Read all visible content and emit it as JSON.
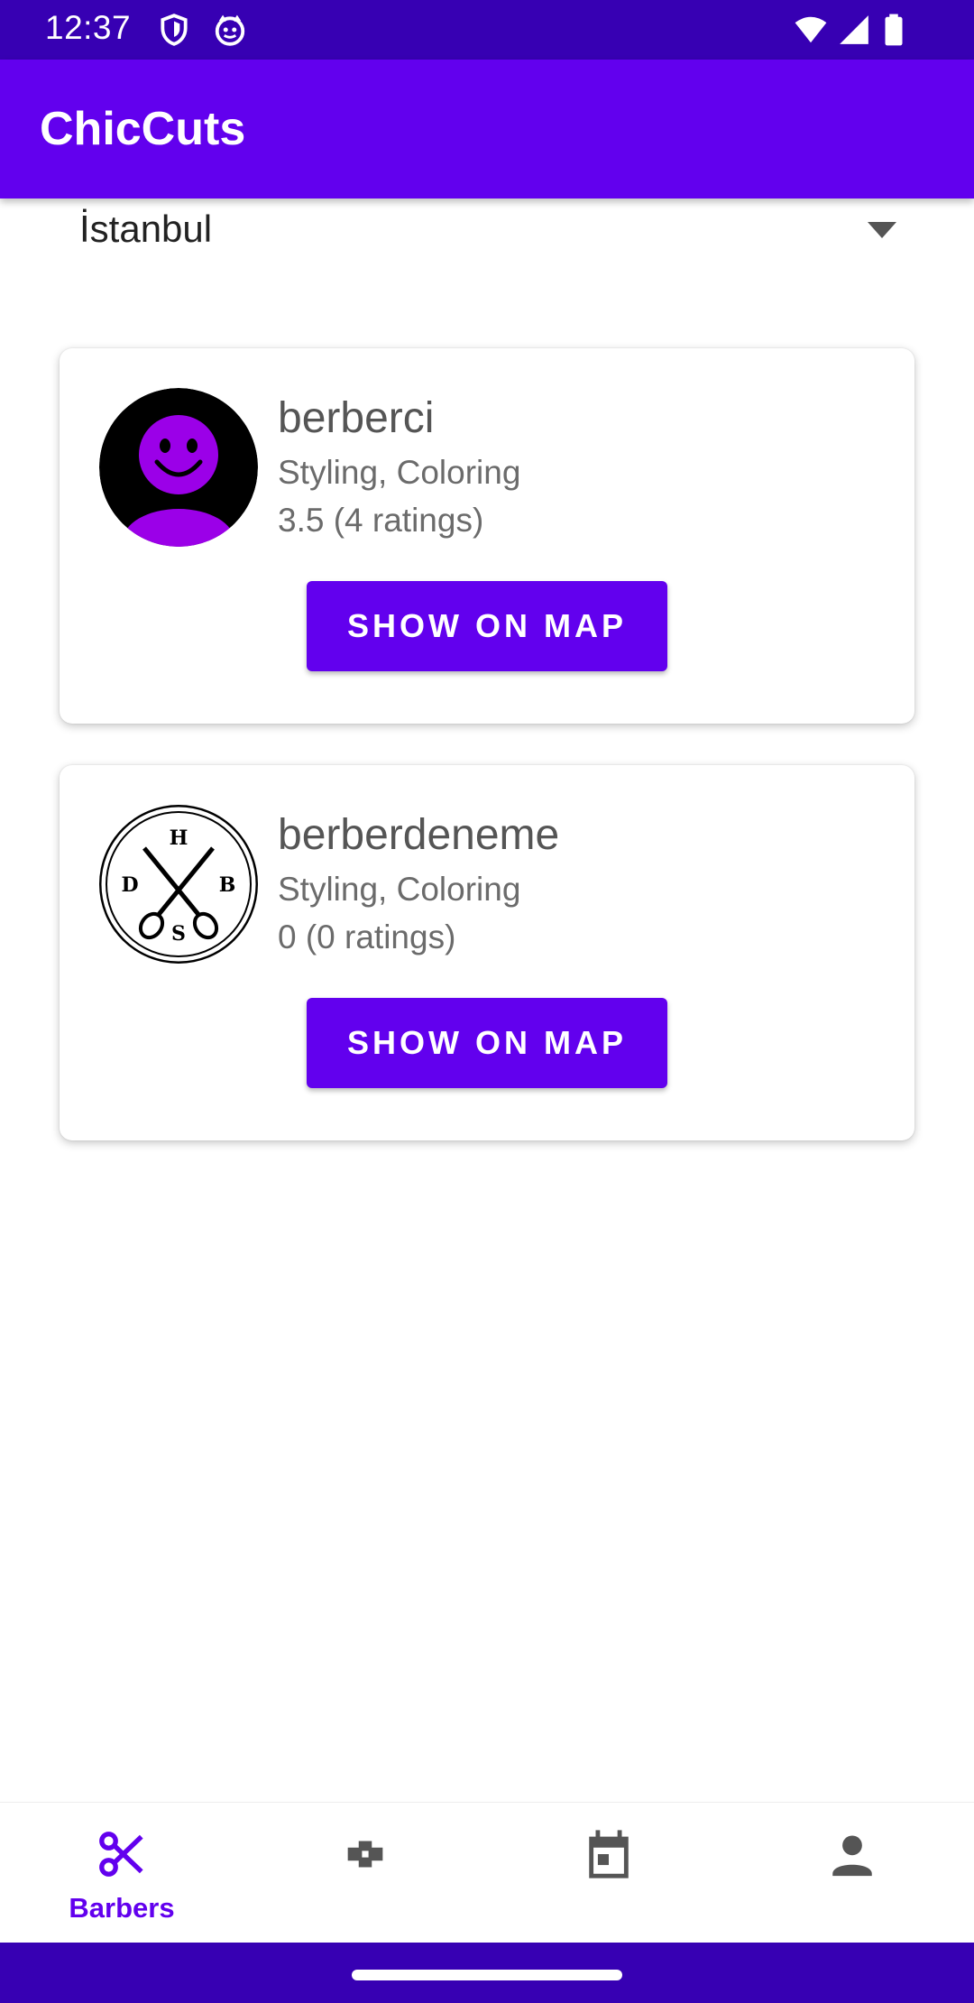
{
  "status_bar": {
    "time": "12:37",
    "icons": [
      "shield-icon",
      "cat-face-icon",
      "wifi-icon",
      "cellular-signal-icon",
      "battery-icon"
    ]
  },
  "app_bar": {
    "title": "ChicCuts"
  },
  "city_select": {
    "selected": "İstanbul"
  },
  "barbers": [
    {
      "name": "berberci",
      "services": "Styling, Coloring",
      "rating": "3.5 (4 ratings)",
      "button_label": "SHOW ON MAP",
      "avatar": "smiley-avatar-icon"
    },
    {
      "name": "berberdeneme",
      "services": "Styling, Coloring",
      "rating": "0 (0 ratings)",
      "button_label": "SHOW ON MAP",
      "avatar": "scissors-logo-icon",
      "logo_letters": [
        "H",
        "D",
        "B",
        "S"
      ]
    }
  ],
  "bottom_nav": {
    "items": [
      {
        "label": "Barbers",
        "icon": "scissors-icon",
        "active": true
      },
      {
        "label": "",
        "icon": "bandage-icon",
        "active": false
      },
      {
        "label": "",
        "icon": "calendar-icon",
        "active": false
      },
      {
        "label": "",
        "icon": "person-icon",
        "active": false
      }
    ]
  },
  "colors": {
    "primary": "#6200EE",
    "primary_dark": "#3700B3",
    "avatar_purple": "#9B00E8",
    "icon_inactive": "#555555"
  }
}
